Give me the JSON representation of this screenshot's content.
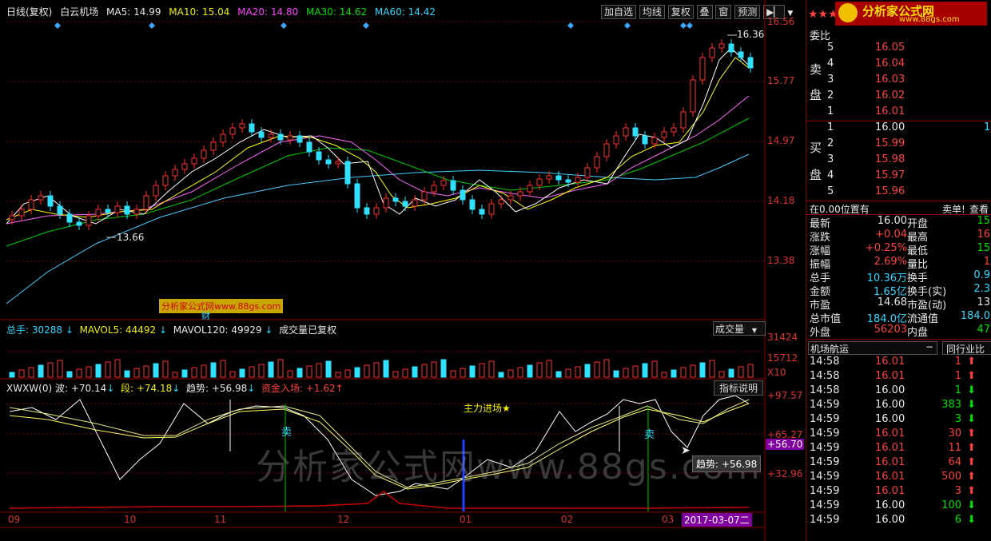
{
  "topbar": {
    "period": "日线(复权)",
    "stock_name": "白云机场",
    "ma5": "MA5: 14.99",
    "ma10": "MA10: 15.04",
    "ma20": "MA20: 14.80",
    "ma30": "MA30: 14.62",
    "ma60": "MA60: 14.42",
    "buttons": [
      "加自选",
      "均线",
      "复权",
      "叠",
      "窗",
      "预测"
    ],
    "colors": {
      "ma5": "#ffffff",
      "ma10": "#ffff00",
      "ma20": "#ff66ff",
      "ma30": "#00ff00",
      "ma60": "#44ccff"
    }
  },
  "price_axis": [
    "16.56",
    "15.77",
    "14.97",
    "14.18",
    "13.38"
  ],
  "annotations": {
    "high": "16.36",
    "low": "13.66",
    "watermark_small": "分析家公式网www.88gs.com",
    "watermark_big": "分析家公式网www.88gs.com",
    "cai": "财",
    "main_in": "主力进场★",
    "sell1": "卖",
    "sell2": "卖"
  },
  "volume": {
    "title_total": "总手: 30288",
    "mavol5": "MAVOL5: 44492",
    "mavol120": "MAVOL120: 49929",
    "note": "成交量已复权",
    "selector": "成交量",
    "axis": [
      "31424",
      "15712",
      "X10"
    ]
  },
  "indicator": {
    "name": "XWXW(0)",
    "bo": "波: +70.14",
    "duan": "段: +74.18",
    "trend": "趋势: +56.98",
    "fund": "资金入场: +1.62",
    "explain_btn": "指标说明",
    "axis": [
      "+97.57",
      "+65.27",
      "+56.70",
      "+32.96"
    ],
    "tooltip": "趋势: +56.98"
  },
  "dates": [
    "09",
    "10",
    "11",
    "12",
    "01",
    "02",
    "03"
  ],
  "current_date": "2017-03-07二",
  "right_panel": {
    "logo": "分析家公式网",
    "logo_url": "www.88gs.com",
    "weibi": "委比",
    "sell_label": [
      "卖",
      "盘"
    ],
    "buy_label": [
      "买",
      "盘"
    ],
    "asks": [
      {
        "lv": "5",
        "price": "16.05"
      },
      {
        "lv": "4",
        "price": "16.04"
      },
      {
        "lv": "3",
        "price": "16.03"
      },
      {
        "lv": "2",
        "price": "16.02"
      },
      {
        "lv": "1",
        "price": "16.01"
      }
    ],
    "bids": [
      {
        "lv": "1",
        "price": "16.00",
        "vol": "1"
      },
      {
        "lv": "2",
        "price": "15.99"
      },
      {
        "lv": "3",
        "price": "15.98"
      },
      {
        "lv": "4",
        "price": "15.97"
      },
      {
        "lv": "5",
        "price": "15.96"
      }
    ],
    "position_line": "在0.00位置有",
    "sell_order": "卖单!",
    "check": "查看",
    "stats": [
      {
        "l": "最新",
        "v": "16.00",
        "l2": "开盘",
        "v2": "15"
      },
      {
        "l": "涨跌",
        "v": "+0.04",
        "l2": "最高",
        "v2": "16"
      },
      {
        "l": "涨幅",
        "v": "+0.25%",
        "l2": "最低",
        "v2": "15"
      },
      {
        "l": "振幅",
        "v": "2.69%",
        "l2": "量比",
        "v2": "1"
      },
      {
        "l": "总手",
        "v": "10.36万",
        "l2": "换手",
        "v2": "0.9"
      },
      {
        "l": "金额",
        "v": "1.65亿",
        "l2": "换手(实)",
        "v2": "2.3"
      },
      {
        "l": "市盈",
        "v": "14.68",
        "l2": "市盈(动)",
        "v2": "13"
      },
      {
        "l": "总市值",
        "v": "184.0亿",
        "l2": "流通值",
        "v2": "184.0"
      },
      {
        "l": "外盘",
        "v": "56203",
        "l2": "内盘",
        "v2": "47"
      }
    ],
    "tab_left": "机场航运",
    "tab_right": "同行业比",
    "ticks": [
      {
        "t": "14:58",
        "p": "16.01",
        "v": "1",
        "d": "up"
      },
      {
        "t": "14:58",
        "p": "16.01",
        "v": "1",
        "d": "up"
      },
      {
        "t": "14:58",
        "p": "16.00",
        "v": "1",
        "d": "down"
      },
      {
        "t": "14:59",
        "p": "16.00",
        "v": "383",
        "d": "down"
      },
      {
        "t": "14:59",
        "p": "16.00",
        "v": "3",
        "d": "down"
      },
      {
        "t": "14:59",
        "p": "16.01",
        "v": "30",
        "d": "up"
      },
      {
        "t": "14:59",
        "p": "16.01",
        "v": "11",
        "d": "up"
      },
      {
        "t": "14:59",
        "p": "16.01",
        "v": "64",
        "d": "up"
      },
      {
        "t": "14:59",
        "p": "16.01",
        "v": "500",
        "d": "up"
      },
      {
        "t": "14:59",
        "p": "16.01",
        "v": "3",
        "d": "up"
      },
      {
        "t": "14:59",
        "p": "16.00",
        "v": "100",
        "d": "down"
      },
      {
        "t": "14:59",
        "p": "16.00",
        "v": "6",
        "d": "down"
      }
    ]
  }
}
